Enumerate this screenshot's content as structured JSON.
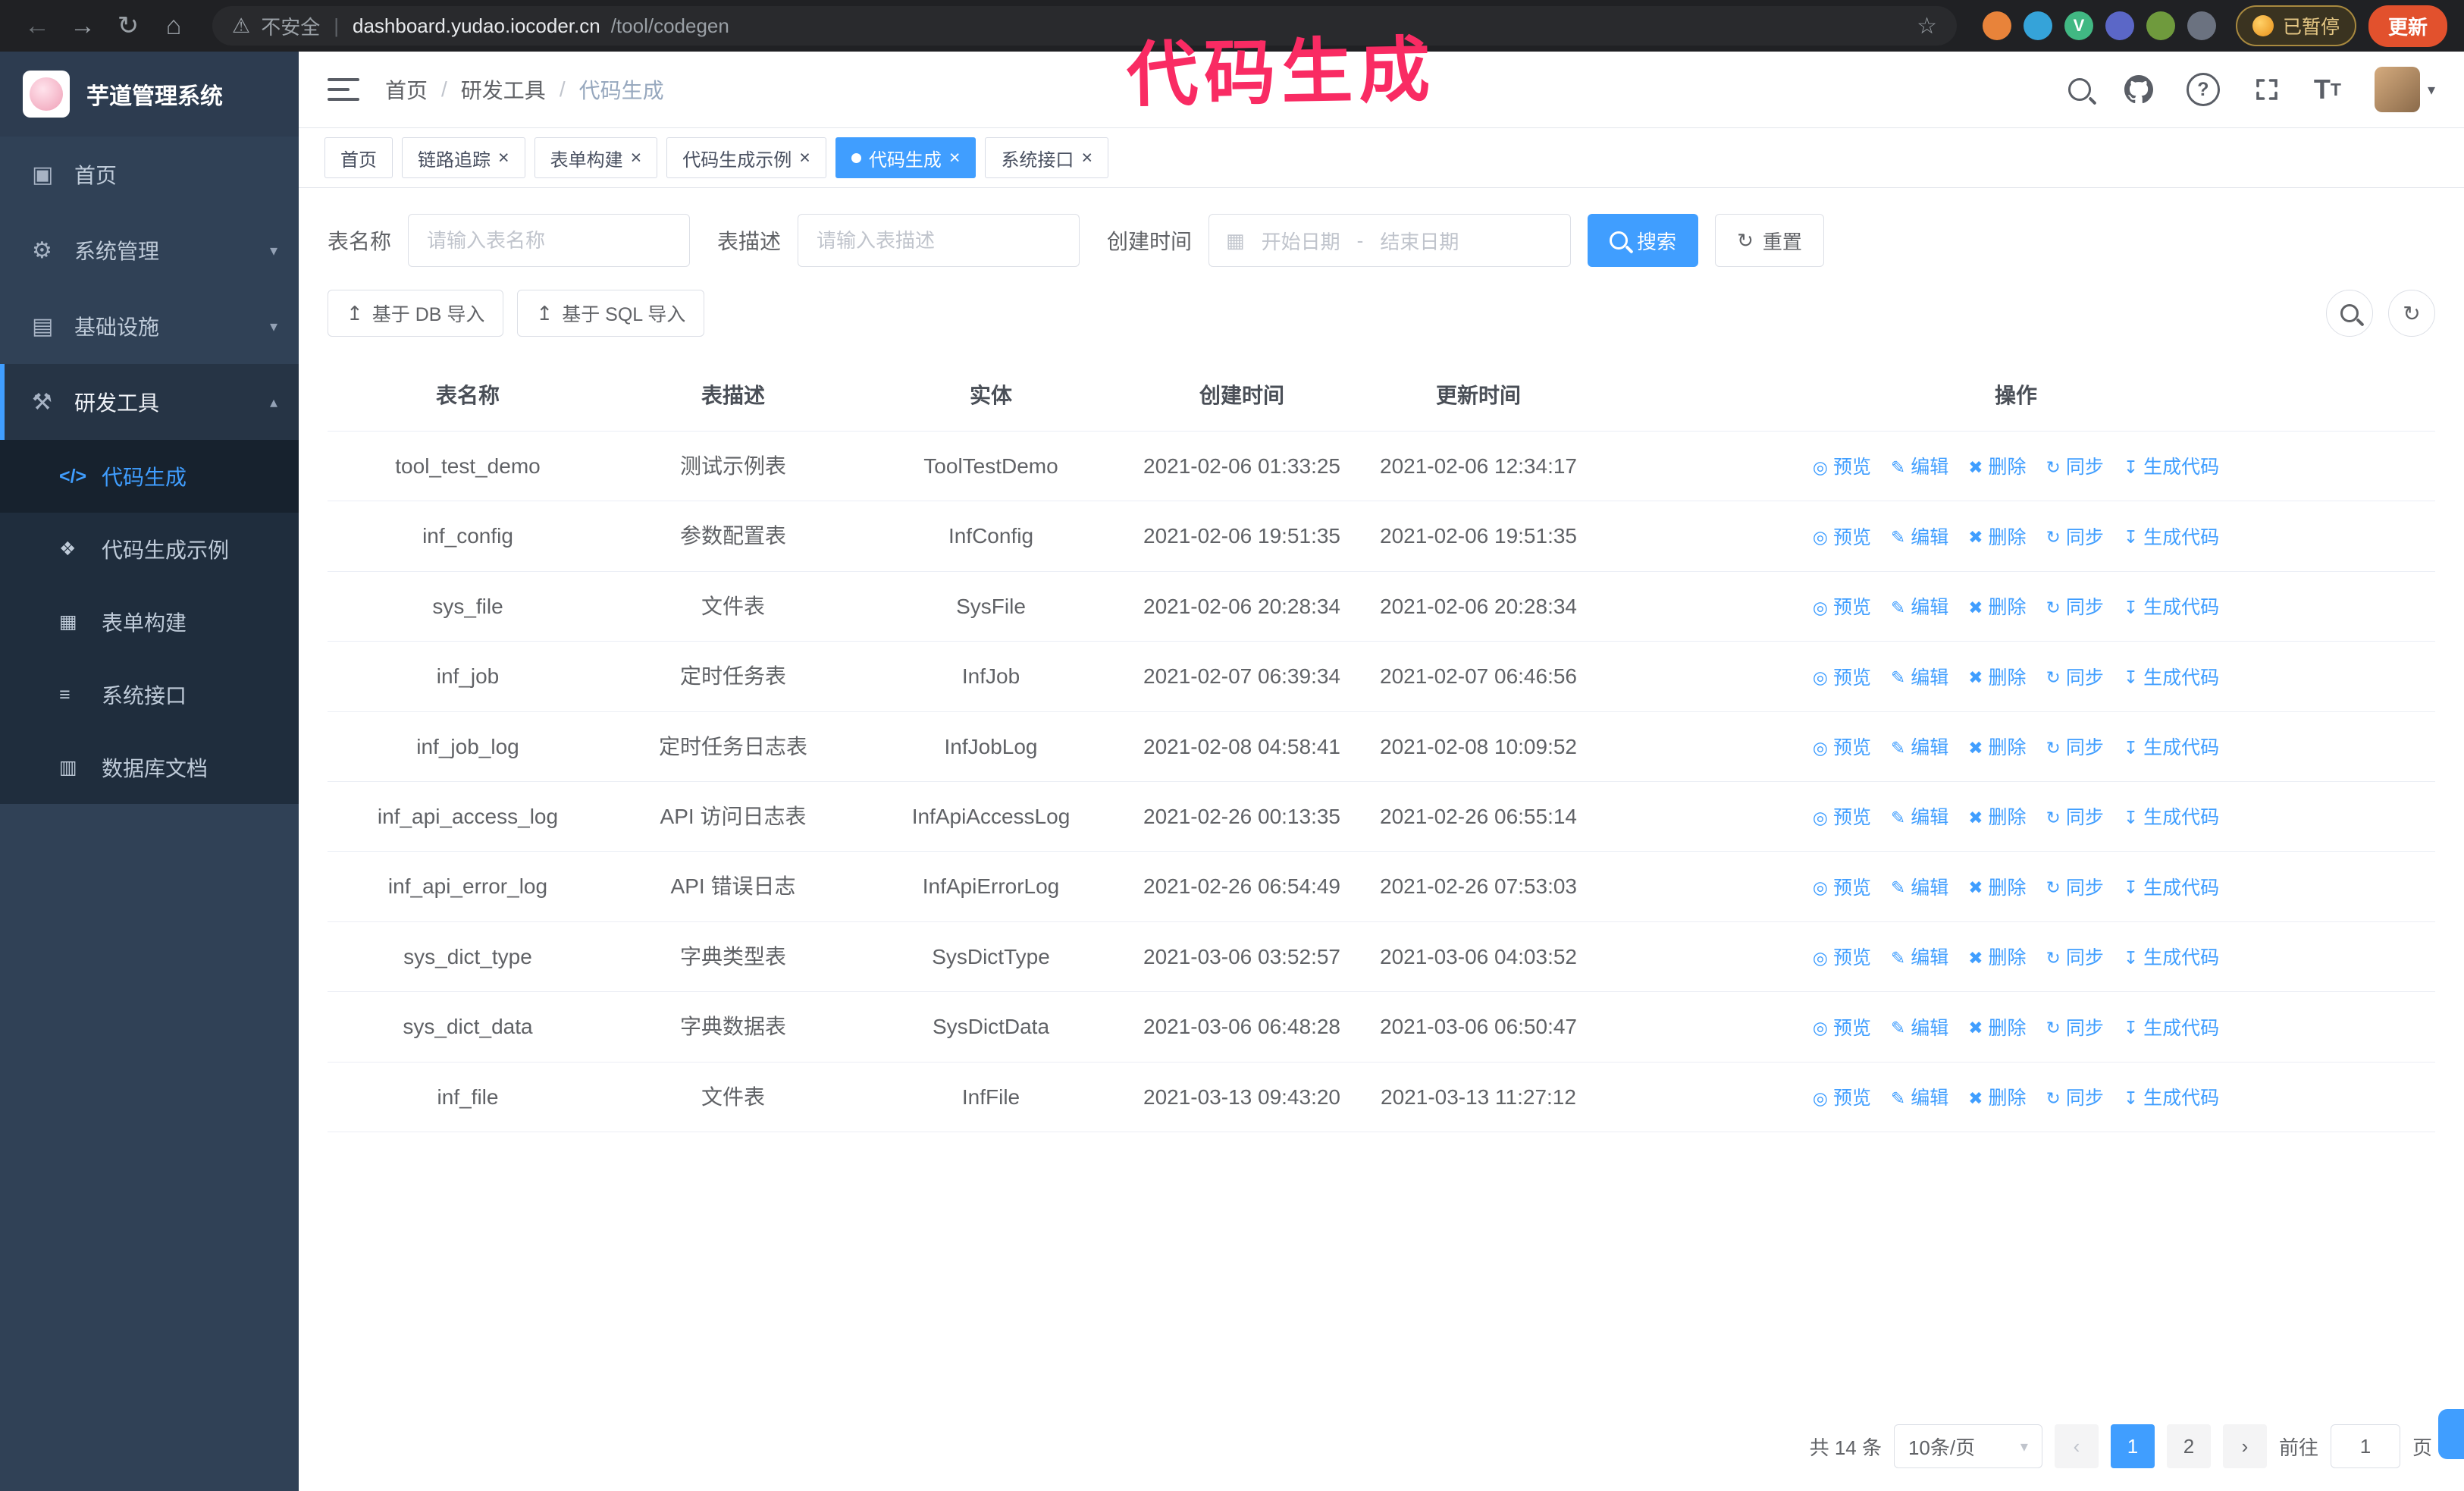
{
  "theme": {
    "accent": "#409eff"
  },
  "annotation": {
    "text": "代码生成",
    "color": "#f92b63"
  },
  "browser": {
    "security_label": "不安全",
    "url_host": "dashboard.yudao.iocoder.cn",
    "url_path": "/tool/codegen",
    "paused_badge": "已暂停",
    "update_button": "更新",
    "extensions": [
      {
        "name": "orange",
        "color": "#e8833a"
      },
      {
        "name": "blue",
        "color": "#35a3d9"
      },
      {
        "name": "vue",
        "color": "#41b883",
        "letter": "V"
      },
      {
        "name": "indigo",
        "color": "#5b67c7"
      },
      {
        "name": "olive",
        "color": "#6f9a3d"
      },
      {
        "name": "gray",
        "color": "#6b7280"
      }
    ]
  },
  "sidebar": {
    "logo_title": "芋道管理系统",
    "menu": [
      {
        "id": "home",
        "label": "首页",
        "icon": "dashboard-icon"
      },
      {
        "id": "system",
        "label": "系统管理",
        "icon": "gear-icon",
        "expandable": true,
        "expanded": false
      },
      {
        "id": "infra",
        "label": "基础设施",
        "icon": "infrastructure-icon",
        "expandable": true,
        "expanded": false
      },
      {
        "id": "devtools",
        "label": "研发工具",
        "icon": "dev-tools-icon",
        "expandable": true,
        "expanded": true,
        "active": true,
        "children": [
          {
            "id": "codegen",
            "label": "代码生成",
            "icon": "code-icon",
            "active": true
          },
          {
            "id": "codegen-example",
            "label": "代码生成示例",
            "icon": "example-icon"
          },
          {
            "id": "form-build",
            "label": "表单构建",
            "icon": "form-icon"
          },
          {
            "id": "api",
            "label": "系统接口",
            "icon": "api-icon"
          },
          {
            "id": "db-doc",
            "label": "数据库文档",
            "icon": "database-icon"
          }
        ]
      }
    ]
  },
  "header": {
    "breadcrumb": [
      "首页",
      "研发工具",
      "代码生成"
    ]
  },
  "tabs": [
    {
      "id": "home",
      "label": "首页",
      "closable": false,
      "active": false
    },
    {
      "id": "tracer",
      "label": "链路追踪",
      "closable": true,
      "active": false
    },
    {
      "id": "form-build",
      "label": "表单构建",
      "closable": true,
      "active": false
    },
    {
      "id": "codegen-example",
      "label": "代码生成示例",
      "closable": true,
      "active": false
    },
    {
      "id": "codegen",
      "label": "代码生成",
      "closable": true,
      "active": true
    },
    {
      "id": "api",
      "label": "系统接口",
      "closable": true,
      "active": false
    }
  ],
  "filters": {
    "table_name_label": "表名称",
    "table_name_placeholder": "请输入表名称",
    "table_desc_label": "表描述",
    "table_desc_placeholder": "请输入表描述",
    "create_time_label": "创建时间",
    "start_date_placeholder": "开始日期",
    "range_separator": "-",
    "end_date_placeholder": "结束日期",
    "search_button": "搜索",
    "reset_button": "重置"
  },
  "toolbar": {
    "import_db_button": "基于 DB 导入",
    "import_sql_button": "基于 SQL 导入"
  },
  "table": {
    "columns": [
      "表名称",
      "表描述",
      "实体",
      "创建时间",
      "更新时间",
      "操作"
    ],
    "row_actions": [
      {
        "id": "preview",
        "label": "预览",
        "icon": "eye-icon"
      },
      {
        "id": "edit",
        "label": "编辑",
        "icon": "edit-icon"
      },
      {
        "id": "delete",
        "label": "删除",
        "icon": "delete-icon"
      },
      {
        "id": "sync",
        "label": "同步",
        "icon": "sync-icon"
      },
      {
        "id": "generate",
        "label": "生成代码",
        "icon": "generate-icon"
      }
    ],
    "rows": [
      {
        "name": "tool_test_demo",
        "desc": "测试示例表",
        "entity": "ToolTestDemo",
        "created": "2021-02-06 01:33:25",
        "updated": "2021-02-06 12:34:17"
      },
      {
        "name": "inf_config",
        "desc": "参数配置表",
        "entity": "InfConfig",
        "created": "2021-02-06 19:51:35",
        "updated": "2021-02-06 19:51:35"
      },
      {
        "name": "sys_file",
        "desc": "文件表",
        "entity": "SysFile",
        "created": "2021-02-06 20:28:34",
        "updated": "2021-02-06 20:28:34"
      },
      {
        "name": "inf_job",
        "desc": "定时任务表",
        "entity": "InfJob",
        "created": "2021-02-07 06:39:34",
        "updated": "2021-02-07 06:46:56"
      },
      {
        "name": "inf_job_log",
        "desc": "定时任务日志表",
        "entity": "InfJobLog",
        "created": "2021-02-08 04:58:41",
        "updated": "2021-02-08 10:09:52"
      },
      {
        "name": "inf_api_access_log",
        "desc": "API 访问日志表",
        "entity": "InfApiAccessLog",
        "created": "2021-02-26 00:13:35",
        "updated": "2021-02-26 06:55:14"
      },
      {
        "name": "inf_api_error_log",
        "desc": "API 错误日志",
        "entity": "InfApiErrorLog",
        "created": "2021-02-26 06:54:49",
        "updated": "2021-02-26 07:53:03"
      },
      {
        "name": "sys_dict_type",
        "desc": "字典类型表",
        "entity": "SysDictType",
        "created": "2021-03-06 03:52:57",
        "updated": "2021-03-06 04:03:52"
      },
      {
        "name": "sys_dict_data",
        "desc": "字典数据表",
        "entity": "SysDictData",
        "created": "2021-03-06 06:48:28",
        "updated": "2021-03-06 06:50:47"
      },
      {
        "name": "inf_file",
        "desc": "文件表",
        "entity": "InfFile",
        "created": "2021-03-13 09:43:20",
        "updated": "2021-03-13 11:27:12"
      }
    ]
  },
  "pagination": {
    "total_text": "共 14 条",
    "page_size_label": "10条/页",
    "pages": [
      "1",
      "2"
    ],
    "current": "1",
    "goto_label": "前往",
    "goto_value": "1",
    "goto_unit": "页"
  }
}
